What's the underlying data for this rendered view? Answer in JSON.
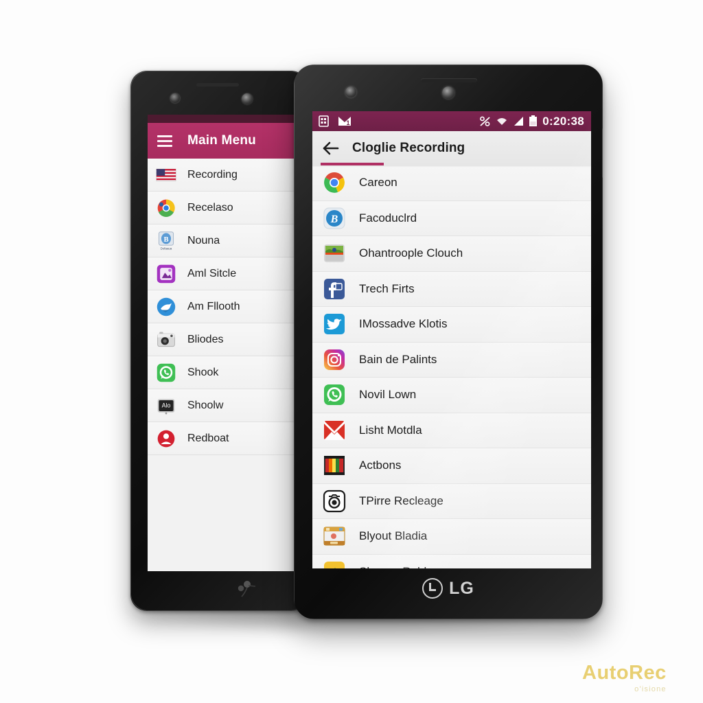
{
  "scene": {
    "background_color": "#fdfdfd",
    "accent_color": "#b02f63",
    "device_brand": "LG"
  },
  "watermark": {
    "main": "AutoRec",
    "sub": "o'isione",
    "color": "#e8cf72"
  },
  "left_phone": {
    "appbar": {
      "menu_icon": "hamburger-icon",
      "title": "Main Menu",
      "background_color": "#b43268"
    },
    "menu_items": [
      {
        "label": "Recording",
        "icon": "us-flag-icon"
      },
      {
        "label": "Recelaso",
        "icon": "chrome-color-icon"
      },
      {
        "label": "Nouna",
        "icon": "blue-b-app-icon"
      },
      {
        "label": "Aml Sitcle",
        "icon": "purple-square-icon"
      },
      {
        "label": "Am Fllooth",
        "icon": "blue-bird-icon"
      },
      {
        "label": "Bliodes",
        "icon": "silver-camera-icon"
      },
      {
        "label": "Shook",
        "icon": "whatsapp-icon"
      },
      {
        "label": "Shoolw",
        "icon": "alo-dark-icon"
      },
      {
        "label": "Redboat",
        "icon": "red-person-icon"
      }
    ]
  },
  "right_phone": {
    "status_bar": {
      "background_color": "#7d2450",
      "left_icons": [
        "sim-card-icon",
        "mail-m1-icon"
      ],
      "right_icons": [
        "mute-percent-icon",
        "wifi-icon",
        "signal-icon",
        "battery-icon"
      ],
      "clock": "0:20:38"
    },
    "toolbar": {
      "back_icon": "back-arrow-icon",
      "title": "Cloglie Recording",
      "indicator_color": "#b02f63"
    },
    "list_items": [
      {
        "label": "Careon",
        "icon": "chrome-icon"
      },
      {
        "label": "Facoduclrd",
        "icon": "blue-b-circle-icon"
      },
      {
        "label": "Ohantroople Clouch",
        "icon": "gallery-landscape-icon"
      },
      {
        "label": "Trech Firts",
        "icon": "facebook-icon"
      },
      {
        "label": "IMossadve Klotis",
        "icon": "twitter-icon"
      },
      {
        "label": "Bain de Palints",
        "icon": "instagram-icon"
      },
      {
        "label": "Novil Lown",
        "icon": "whatsapp-icon"
      },
      {
        "label": "Lisht Motdla",
        "icon": "red-x-mail-icon"
      },
      {
        "label": "Actbons",
        "icon": "color-stripes-icon"
      },
      {
        "label": "TPirre Recleage",
        "icon": "bw-camera-icon"
      },
      {
        "label": "Blyout Bladia",
        "icon": "calendar-app-icon"
      },
      {
        "label": "Shome, Rubla",
        "icon": "yellow-fm-icon"
      }
    ]
  }
}
